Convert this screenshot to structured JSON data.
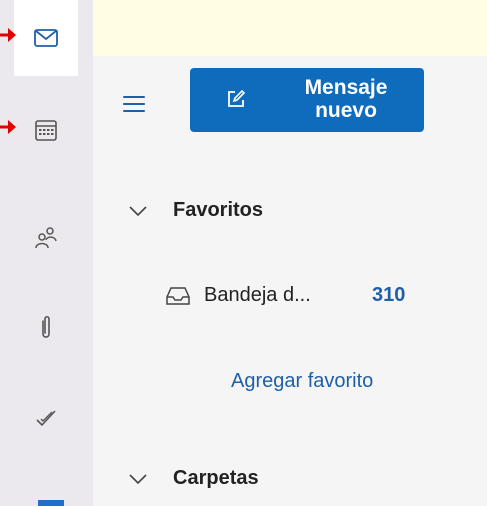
{
  "rail": {
    "items": [
      {
        "icon": "mail-icon",
        "active": true
      },
      {
        "icon": "calendar-icon",
        "active": false
      },
      {
        "icon": "people-icon",
        "active": false
      },
      {
        "icon": "paperclip-icon",
        "active": false
      },
      {
        "icon": "checkmark-icon",
        "active": false
      }
    ]
  },
  "toolbar": {
    "new_message_label": "Mensaje nuevo"
  },
  "folders": {
    "favorites_label": "Favoritos",
    "inbox_label": "Bandeja d...",
    "inbox_count": "310",
    "add_favorite_label": "Agregar favorito",
    "folders_label": "Carpetas"
  },
  "colors": {
    "accent": "#0f6cbd",
    "banner": "#fffde3",
    "annotation_arrow": "#e00000"
  }
}
